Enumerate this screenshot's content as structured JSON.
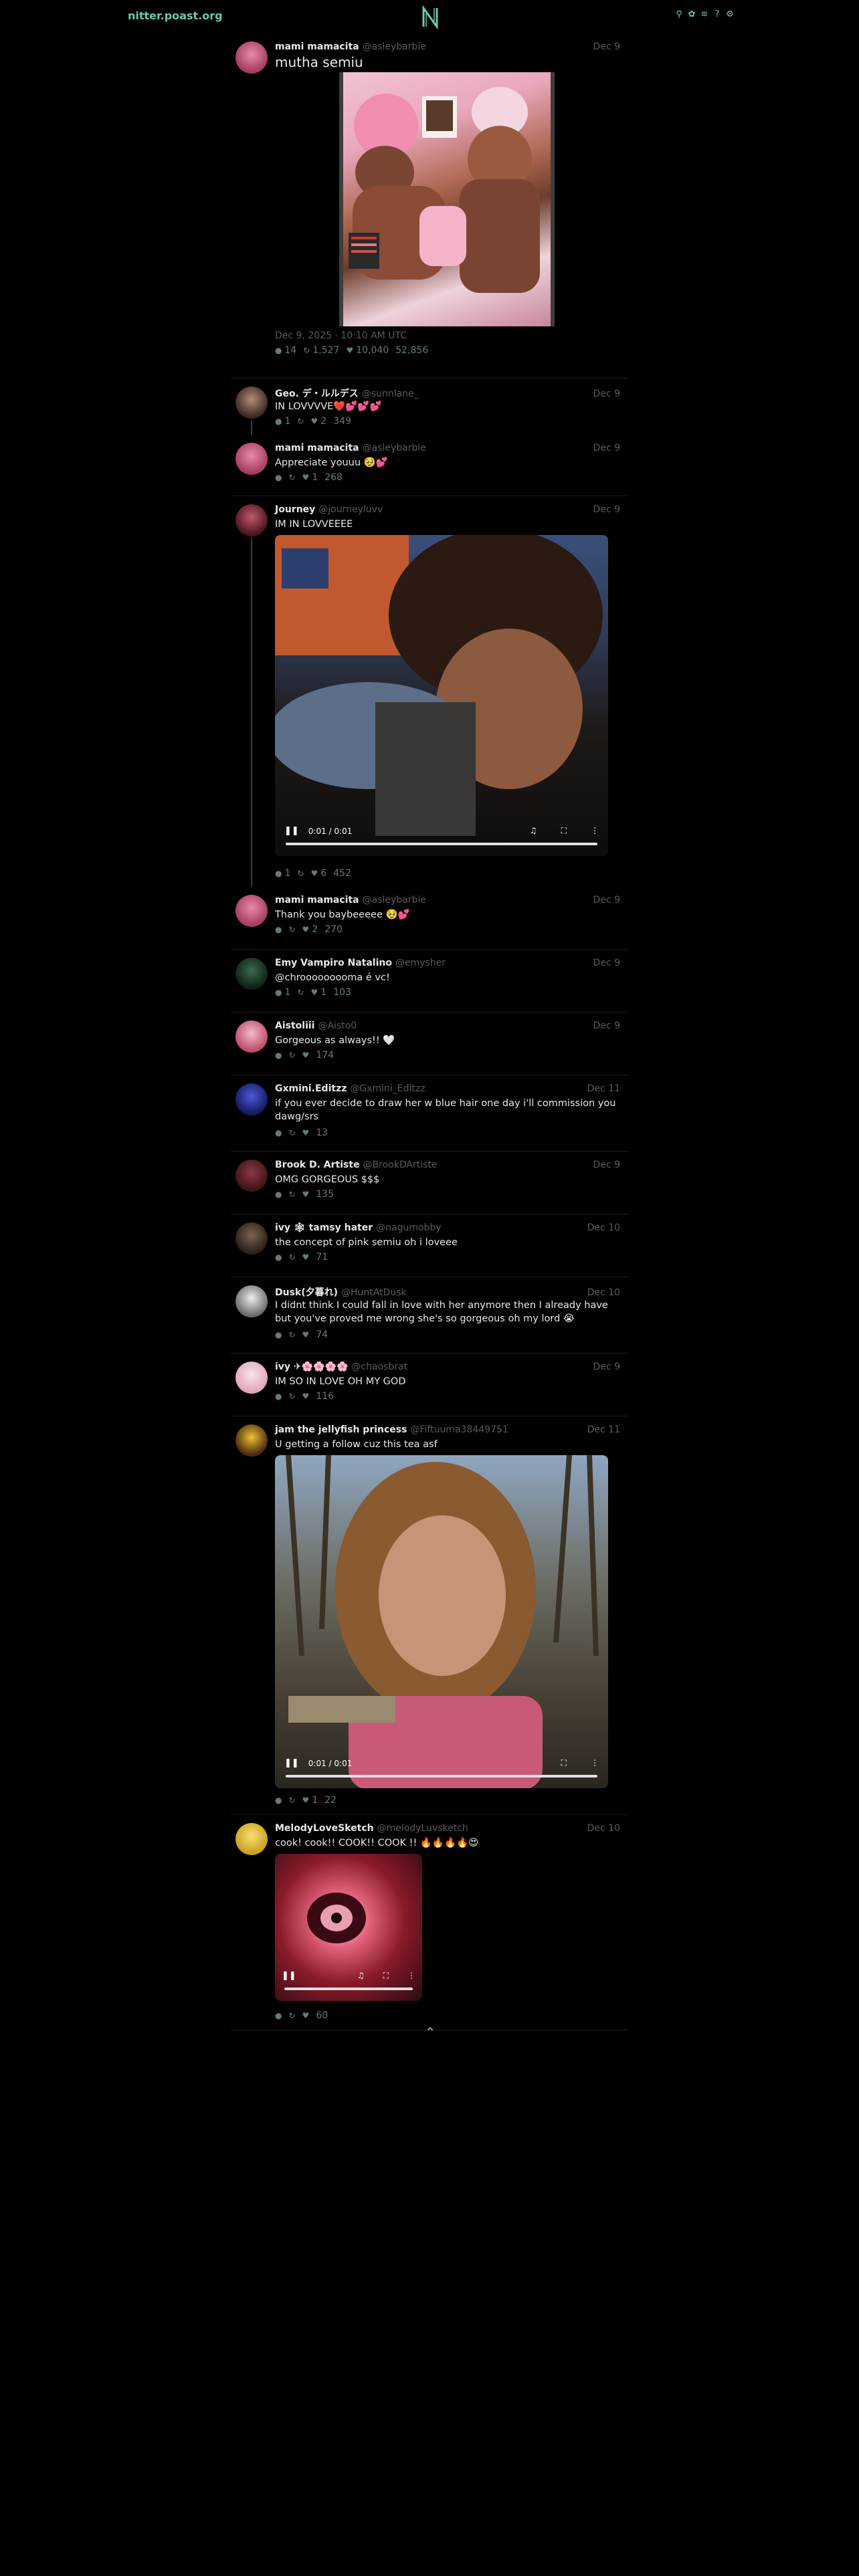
{
  "nav": {
    "brand": "nitter.poast.org",
    "logo": "N"
  },
  "colors": {
    "accent": "#6cc9a8",
    "stats": "#5f7f74",
    "muted": "#5a5a5a",
    "background": "#000000"
  },
  "icons": [
    "search-icon",
    "twitter-icon",
    "rss-icon",
    "info-icon",
    "settings-icon"
  ],
  "main_tweet": {
    "name": "mami mamacita",
    "handle": "@asleybarbie",
    "date": "Dec 9",
    "text": "mutha semiu",
    "timestamp": "Dec 9, 2025 · 10:10 AM UTC",
    "replies": "14",
    "retweets": "1,527",
    "likes": "10,040",
    "views": "52,856"
  },
  "tweets": [
    {
      "name": "Geo. デ・ルルデス",
      "handle": "@sunnlane_",
      "date": "Dec 9",
      "text": "IN LOVVVVE❤️💕💕💕",
      "replies": "1",
      "likes": "2",
      "views": "349"
    },
    {
      "name": "mami mamacita",
      "handle": "@asleybarbie",
      "date": "Dec 9",
      "text": "Appreciate youuu 🥹💕",
      "likes": "1",
      "views": "268"
    },
    {
      "name": "Journey",
      "handle": "@journeyluvv",
      "date": "Dec 9",
      "text": "IM IN LOVVEEEE",
      "video_time": "0:01 / 0:01",
      "replies": "1",
      "likes": "6",
      "views": "452"
    },
    {
      "name": "mami mamacita",
      "handle": "@asleybarbie",
      "date": "Dec 9",
      "text": "Thank you baybeeeee 🥹💕",
      "likes": "2",
      "views": "270"
    },
    {
      "name": "Emy Vampiro Natalino",
      "handle": "@emysher",
      "date": "Dec 9",
      "text": "@chrooooooooma é vc!",
      "replies": "1",
      "likes": "1",
      "views": "103"
    },
    {
      "name": "Aistoliii",
      "handle": "@Aisto0",
      "date": "Dec 9",
      "text": "Gorgeous as always!! 🤍",
      "views": "174"
    },
    {
      "name": "Gxmini.Editzz",
      "handle": "@Gxmini_Editzz",
      "date": "Dec 11",
      "text": "if you ever decide to draw her w blue hair one day i'll commission you dawg/srs",
      "views": "13"
    },
    {
      "name": "Brook D. Artiste",
      "handle": "@BrookDArtiste",
      "date": "Dec 9",
      "text": "OMG GORGEOUS $$$",
      "views": "135"
    },
    {
      "name": "ivy 🕸 tamsy hater",
      "handle": "@nagumobby",
      "date": "Dec 10",
      "text": "the concept of pink semiu oh i loveee",
      "views": "71"
    },
    {
      "name": "Dusk(夕暮れ)",
      "handle": "@HuntAtDusk",
      "date": "Dec 10",
      "text": "I didnt think I could fall in love with her anymore then I already have but you've proved me wrong she's so gorgeous oh my lord 😭",
      "views": "74"
    },
    {
      "name": "ivy ✈︎🌸🌸🌸🌸",
      "handle": "@chaosbrat",
      "date": "Dec 9",
      "text": "IM SO IN LOVE OH MY GOD",
      "views": "116"
    },
    {
      "name": "jam the jellyfish princess",
      "handle": "@Fiftuuma38449751",
      "date": "Dec 11",
      "text": "U getting a follow cuz this tea asf",
      "video_time": "0:01 / 0:01",
      "likes": "1",
      "views": "22"
    },
    {
      "name": "MelodyLoveSketch",
      "handle": "@melodyLuvsketch",
      "date": "Dec 10",
      "text": "cook! cook!! COOK!! COOK !! 🔥🔥🔥🔥😍",
      "views": "60"
    }
  ]
}
